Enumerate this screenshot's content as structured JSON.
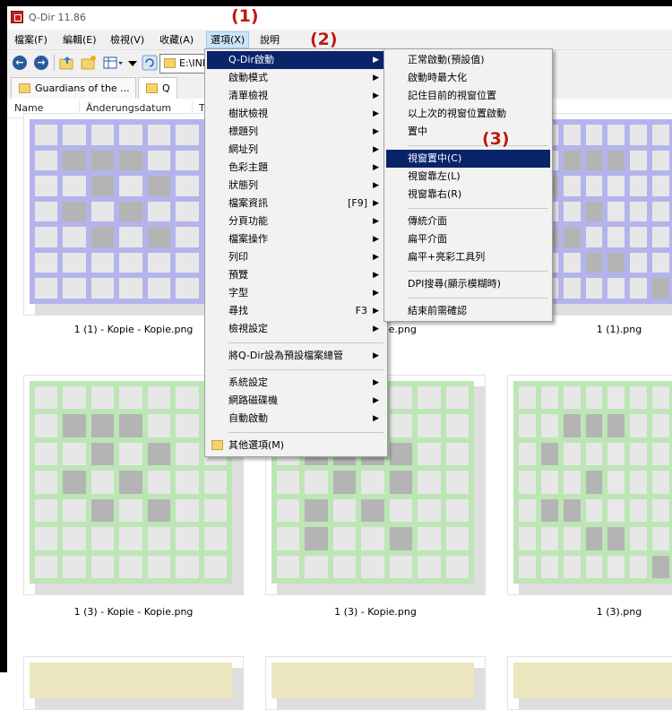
{
  "window": {
    "title": "Q-Dir 11.86"
  },
  "menubar": {
    "items": [
      {
        "label": "檔案(F)"
      },
      {
        "label": "編輯(E)"
      },
      {
        "label": "檢視(V)"
      },
      {
        "label": "收藏(A)"
      },
      {
        "label": "選項(X)"
      },
      {
        "label": "說明"
      }
    ]
  },
  "toolbar": {
    "back": "←",
    "forward": "→",
    "address": "E:\\INI"
  },
  "tabs": [
    {
      "label": "Guardians of the ..."
    },
    {
      "label": "Q"
    }
  ],
  "columns": [
    "Name",
    "Änderungsdatum",
    "T"
  ],
  "annotations": [
    "(1)",
    "(2)",
    "(3)"
  ],
  "files": [
    {
      "name": "1 (1) - Kopie - Kopie.png",
      "grid_color": "#b4b4ec"
    },
    {
      "name": "1 (1) - Kopie.png",
      "grid_color": "#b4b4ec"
    },
    {
      "name": "1 (1).png",
      "grid_color": "#b4b4ec"
    },
    {
      "name": "1 (3) - Kopie - Kopie.png",
      "grid_color": "#bde5b6"
    },
    {
      "name": "1 (3) - Kopie.png",
      "grid_color": "#bde5b6"
    },
    {
      "name": "1 (3).png",
      "grid_color": "#bde5b6"
    },
    {
      "grid_color": "#ece7bf"
    },
    {
      "grid_color": "#ece7bf"
    },
    {
      "grid_color": "#ece7bf"
    }
  ],
  "options_menu": {
    "items": [
      {
        "label": "Q-Dir啟動",
        "submenu": true,
        "highlighted": true
      },
      {
        "label": "啟動模式",
        "submenu": true
      },
      {
        "label": "清單檢視",
        "submenu": true
      },
      {
        "label": "樹狀檢視",
        "submenu": true
      },
      {
        "label": "標題列",
        "submenu": true
      },
      {
        "label": "網址列",
        "submenu": true
      },
      {
        "label": "色彩主題",
        "submenu": true
      },
      {
        "label": "狀態列",
        "submenu": true
      },
      {
        "label": "檔案資訊",
        "shortcut": "[F9]",
        "submenu": true
      },
      {
        "label": "分頁功能",
        "submenu": true
      },
      {
        "label": "檔案操作",
        "submenu": true
      },
      {
        "label": "列印",
        "submenu": true
      },
      {
        "label": "預覽",
        "submenu": true
      },
      {
        "label": "字型",
        "submenu": true
      },
      {
        "label": "尋找",
        "shortcut": "F3",
        "submenu": true
      },
      {
        "label": "檢視設定",
        "submenu": true
      },
      {
        "label": "將Q-Dir設為預設檔案總管",
        "submenu": true
      },
      {
        "label": "系統設定",
        "submenu": true
      },
      {
        "label": "網路磁碟機",
        "submenu": true
      },
      {
        "label": "自動啟動",
        "submenu": true
      },
      {
        "label": "其他選項(M)",
        "icon": "folder-icon"
      }
    ]
  },
  "startup_submenu": {
    "items": [
      {
        "label": "正常啟動(預設值)"
      },
      {
        "label": "啟動時最大化"
      },
      {
        "label": "記住目前的視窗位置"
      },
      {
        "label": "以上次的視窗位置啟動"
      },
      {
        "label": "置中"
      },
      {
        "label": "視窗置中(C)",
        "highlighted": true
      },
      {
        "label": "視窗靠左(L)"
      },
      {
        "label": "視窗靠右(R)"
      },
      {
        "label": "傳統介面"
      },
      {
        "label": "扁平介面"
      },
      {
        "label": "扁平+亮彩工具列"
      },
      {
        "label": "DPI搜尋(顯示模糊時)"
      },
      {
        "label": "結束前需確認"
      }
    ]
  },
  "colors": {
    "highlight": "#0a246a",
    "annotation": "#c0180f",
    "menu_bg": "#f2f2f2"
  }
}
